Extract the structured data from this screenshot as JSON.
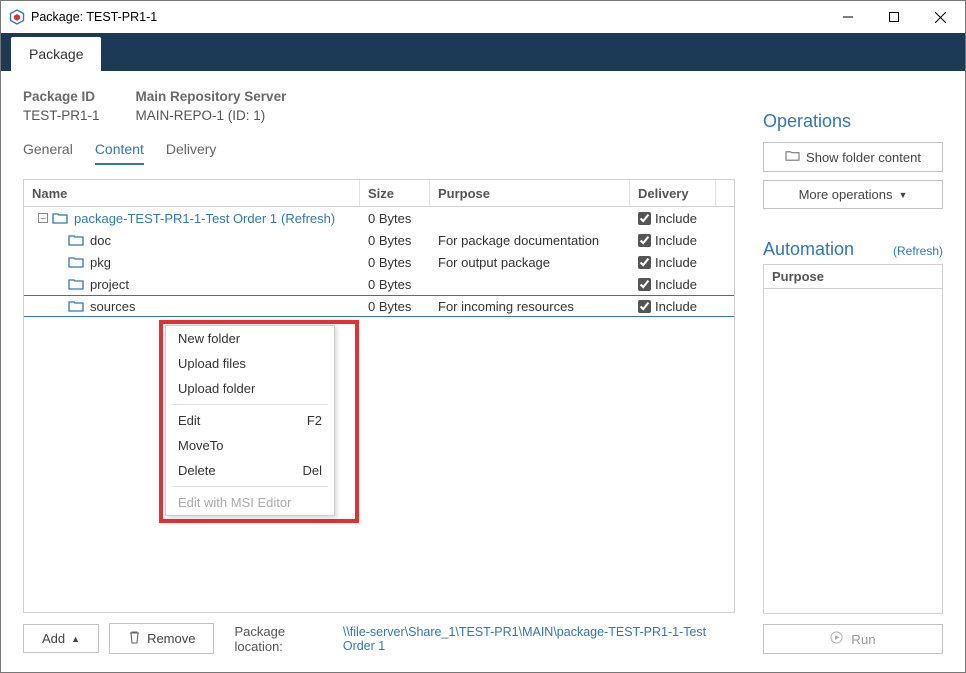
{
  "window": {
    "title": "Package: TEST-PR1-1"
  },
  "tab": {
    "label": "Package"
  },
  "header": {
    "pkgid_label": "Package ID",
    "pkgid_value": "TEST-PR1-1",
    "repo_label": "Main Repository Server",
    "repo_value": "MAIN-REPO-1 (ID: 1)"
  },
  "subtabs": {
    "general": "General",
    "content": "Content",
    "delivery": "Delivery"
  },
  "table": {
    "headers": {
      "name": "Name",
      "size": "Size",
      "purpose": "Purpose",
      "delivery": "Delivery"
    },
    "root": {
      "name": "package-TEST-PR1-1-Test Order 1",
      "refresh": "(Refresh)",
      "size": "0 Bytes",
      "include": "Include"
    },
    "rows": [
      {
        "name": "doc",
        "size": "0 Bytes",
        "purpose": "For package documentation",
        "include": "Include"
      },
      {
        "name": "pkg",
        "size": "0 Bytes",
        "purpose": "For output package",
        "include": "Include"
      },
      {
        "name": "project",
        "size": "0 Bytes",
        "purpose": "",
        "include": "Include"
      },
      {
        "name": "sources",
        "size": "0 Bytes",
        "purpose": "For incoming resources",
        "include": "Include"
      }
    ]
  },
  "context_menu": {
    "new_folder": "New folder",
    "upload_files": "Upload files",
    "upload_folder": "Upload folder",
    "edit": "Edit",
    "edit_shortcut": "F2",
    "moveto": "MoveTo",
    "delete": "Delete",
    "delete_shortcut": "Del",
    "edit_msi": "Edit with MSI Editor"
  },
  "bottom": {
    "add": "Add",
    "remove": "Remove",
    "loc_label": "Package location:",
    "loc_path": "\\\\file-server\\Share_1\\TEST-PR1\\MAIN\\package-TEST-PR1-1-Test Order 1"
  },
  "right": {
    "operations": "Operations",
    "show_folder": "Show folder content",
    "more_ops": "More operations",
    "automation": "Automation",
    "refresh": "(Refresh)",
    "purpose": "Purpose",
    "run": "Run"
  }
}
